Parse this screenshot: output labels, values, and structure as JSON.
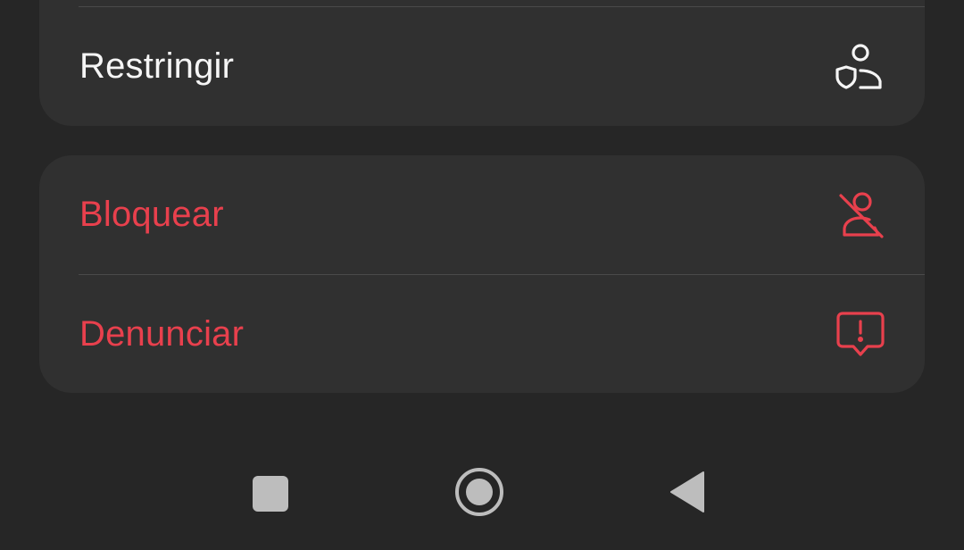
{
  "menu": {
    "restrict": {
      "label": "Restringir",
      "icon": "user-shield-icon"
    },
    "block": {
      "label": "Bloquear",
      "icon": "user-slash-icon"
    },
    "report": {
      "label": "Denunciar",
      "icon": "report-bubble-icon"
    }
  },
  "navbar": {
    "recents": {
      "icon": "square-icon"
    },
    "home": {
      "icon": "circle-icon"
    },
    "back": {
      "icon": "triangle-back-icon"
    }
  },
  "colors": {
    "background": "#262626",
    "card": "#303030",
    "danger": "#e8404d",
    "text": "#f5f5f5",
    "nav_icon": "#bdbdbd"
  }
}
